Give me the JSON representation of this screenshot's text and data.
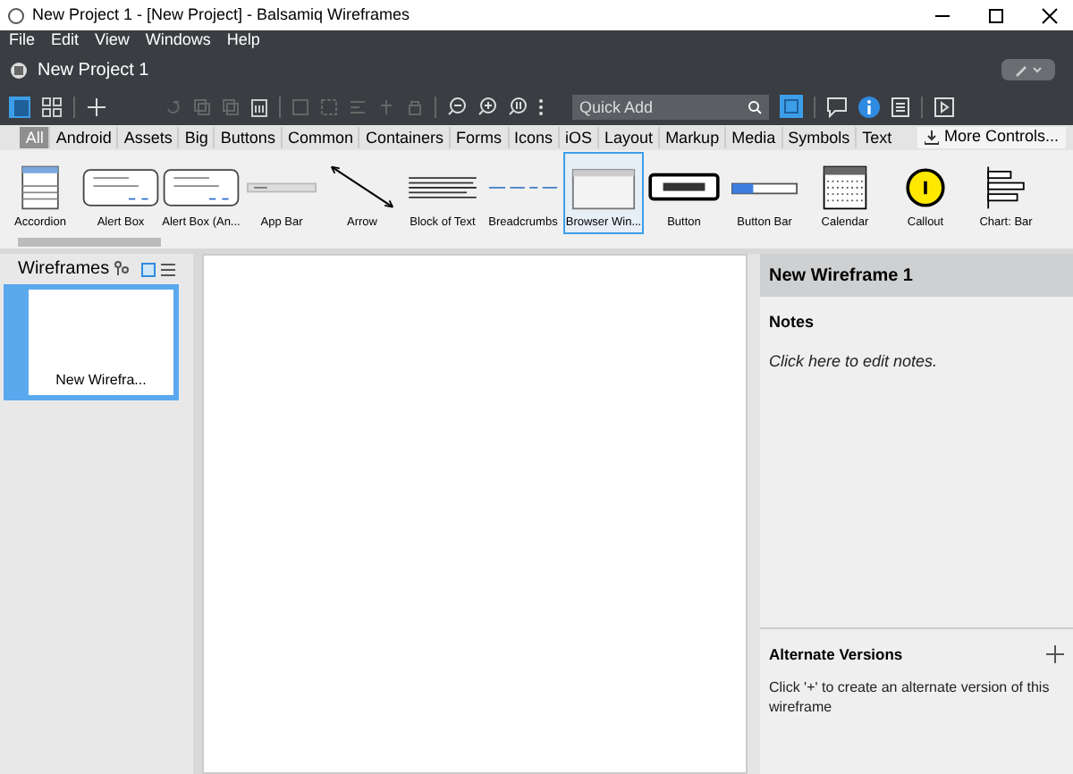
{
  "window": {
    "title": "New Project 1 - [New Project] - Balsamiq Wireframes"
  },
  "menu": [
    "File",
    "Edit",
    "View",
    "Windows",
    "Help"
  ],
  "project": {
    "title": "New Project 1"
  },
  "toolbar": {
    "quick_add": {
      "placeholder": "Quick Add"
    }
  },
  "categories": [
    {
      "label": "All",
      "selected": true
    },
    {
      "label": "Android",
      "selected": false
    },
    {
      "label": "Assets",
      "selected": false
    },
    {
      "label": "Big",
      "selected": false
    },
    {
      "label": "Buttons",
      "selected": false
    },
    {
      "label": "Common",
      "selected": false
    },
    {
      "label": "Containers",
      "selected": false
    },
    {
      "label": "Forms",
      "selected": false
    },
    {
      "label": "Icons",
      "selected": false
    },
    {
      "label": "iOS",
      "selected": false
    },
    {
      "label": "Layout",
      "selected": false
    },
    {
      "label": "Markup",
      "selected": false
    },
    {
      "label": "Media",
      "selected": false
    },
    {
      "label": "Symbols",
      "selected": false
    },
    {
      "label": "Text",
      "selected": false
    }
  ],
  "more_controls": "More Controls...",
  "components": [
    {
      "label": "Accordion",
      "kind": "accordion",
      "selected": false
    },
    {
      "label": "Alert Box",
      "kind": "alert",
      "selected": false
    },
    {
      "label": "Alert Box (An...",
      "kind": "alert",
      "selected": false
    },
    {
      "label": "App Bar",
      "kind": "appbar",
      "selected": false
    },
    {
      "label": "Arrow",
      "kind": "arrow",
      "selected": false
    },
    {
      "label": "Block of Text",
      "kind": "text",
      "selected": false
    },
    {
      "label": "Breadcrumbs",
      "kind": "crumbs",
      "selected": false
    },
    {
      "label": "Browser Win...",
      "kind": "browser",
      "selected": true
    },
    {
      "label": "Button",
      "kind": "button",
      "selected": false
    },
    {
      "label": "Button Bar",
      "kind": "buttonbar",
      "selected": false
    },
    {
      "label": "Calendar",
      "kind": "calendar",
      "selected": false
    },
    {
      "label": "Callout",
      "kind": "callout",
      "selected": false
    },
    {
      "label": "Chart: Bar",
      "kind": "chart",
      "selected": false
    }
  ],
  "wireframes": {
    "title": "Wireframes",
    "items": [
      {
        "label": "New Wirefra...",
        "selected": true
      }
    ]
  },
  "inspector": {
    "title": "New Wireframe 1",
    "notes_heading": "Notes",
    "notes_placeholder": "Click here to edit notes.",
    "alternate_heading": "Alternate Versions",
    "alternate_text": "Click '+' to create an alternate version of this wireframe"
  }
}
